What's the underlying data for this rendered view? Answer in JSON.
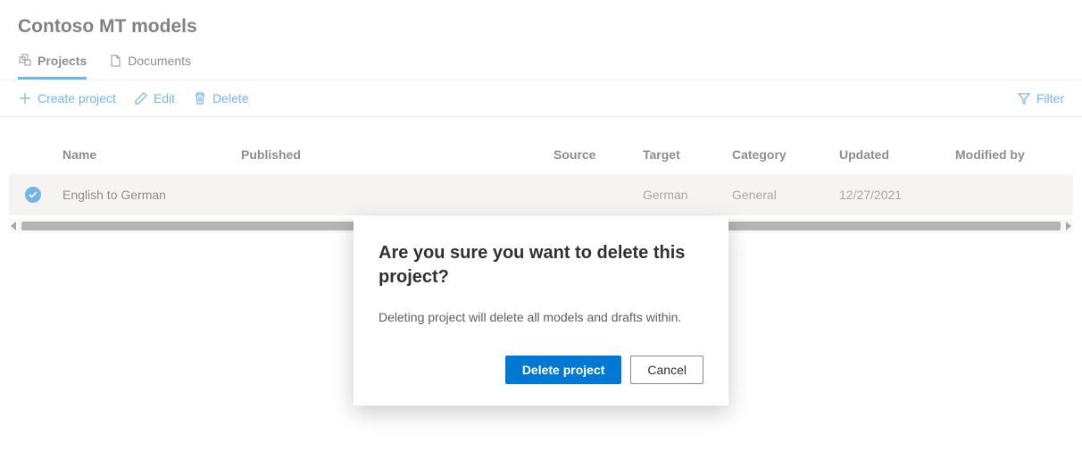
{
  "page_title": "Contoso MT models",
  "tabs": {
    "projects": "Projects",
    "documents": "Documents"
  },
  "commands": {
    "create": "Create project",
    "edit": "Edit",
    "delete": "Delete",
    "filter": "Filter"
  },
  "table": {
    "headers": {
      "name": "Name",
      "published": "Published",
      "source": "Source",
      "target": "Target",
      "category": "Category",
      "updated": "Updated",
      "modified_by": "Modified by"
    },
    "rows": [
      {
        "selected": true,
        "name": "English to German",
        "published": "",
        "source": "",
        "target": "German",
        "category": "General",
        "updated": "12/27/2021",
        "modified_by": ""
      }
    ]
  },
  "dialog": {
    "title": "Are you sure you want to delete this project?",
    "body": "Deleting project will delete all models and drafts within.",
    "confirm": "Delete project",
    "cancel": "Cancel"
  }
}
